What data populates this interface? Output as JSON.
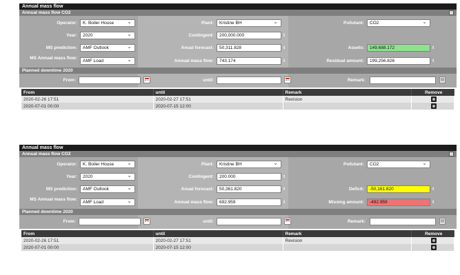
{
  "panels": [
    {
      "title": "Annual mass flow",
      "subtitle": "Annual mass flow CO2",
      "labels": {
        "operator": "Operator:",
        "year": "Year:",
        "ms_prediction": "MS prediction:",
        "ms_annual": "MS Annual mass flow:",
        "plant": "Plant:",
        "contingent": "Contingent:",
        "anual_forecast": "Anual forecast:",
        "annual_mass_flow": "Annual mass flow:",
        "pollutant": "Pollutant:",
        "c3r3": "Assets:",
        "c3r4": "Residual amount:"
      },
      "values": {
        "operator": "K. Boiler House",
        "year": "2020",
        "ms_prediction": "AMF Outlook",
        "ms_annual": "AMF Load",
        "plant": "Kristine BH",
        "contingent": "200,000.000",
        "anual_forecast": "50,311.828",
        "annual_mass_flow": "743.174",
        "pollutant": "CO2",
        "c3r3": "149,688.172",
        "c3r4": "199,256.826"
      },
      "unit": "t",
      "downtime": {
        "title": "Planned downtime 2020",
        "from_label": "From:",
        "until_label": "until:",
        "remark_label": "Remark:",
        "from_value": "",
        "until_value": "",
        "remark_value": ""
      },
      "table": {
        "headers": [
          "From",
          "until",
          "Remark",
          "Remove"
        ],
        "rows": [
          {
            "from": "2020-02-26 17:51",
            "until": "2020-02-27 17:51",
            "remark": "Revision"
          },
          {
            "from": "2020-07-01 00:00",
            "until": "2020-07-15 12:00",
            "remark": ""
          }
        ]
      }
    },
    {
      "title": "Annual mass flow",
      "subtitle": "Annual mass flow CO2",
      "labels": {
        "operator": "Operator:",
        "year": "Year:",
        "ms_prediction": "MS prediction:",
        "ms_annual": "MS Annual mass flow:",
        "plant": "Plant:",
        "contingent": "Contingent:",
        "anual_forecast": "Anual forecast:",
        "annual_mass_flow": "Annual mass flow:",
        "pollutant": "Pollutant:",
        "c3r3": "Deficit:",
        "c3r4": "Missing amount:"
      },
      "values": {
        "operator": "K. Boiler House",
        "year": "2020",
        "ms_prediction": "AMF Outlook",
        "ms_annual": "AMF Load",
        "plant": "Kristine BH",
        "contingent": "200.000",
        "anual_forecast": "50,361.820",
        "annual_mass_flow": "692.959",
        "pollutant": "CO2",
        "c3r3": "-50,161.820",
        "c3r4": "-492.959"
      },
      "unit": "t",
      "downtime": {
        "title": "Planned downtime 2020",
        "from_label": "From:",
        "until_label": "until:",
        "remark_label": "Remark:",
        "from_value": "",
        "until_value": "",
        "remark_value": ""
      },
      "table": {
        "headers": [
          "From",
          "until",
          "Remark",
          "Remove"
        ],
        "rows": [
          {
            "from": "2020-02-26 17:51",
            "until": "2020-02-27 17:51",
            "remark": "Revision"
          },
          {
            "from": "2020-07-01 00:00",
            "until": "2020-07-15 12:00",
            "remark": ""
          }
        ]
      }
    }
  ],
  "colors": {
    "assets_ok": "#8de38d",
    "deficit": "#ffff00",
    "missing": "#ee7474"
  }
}
